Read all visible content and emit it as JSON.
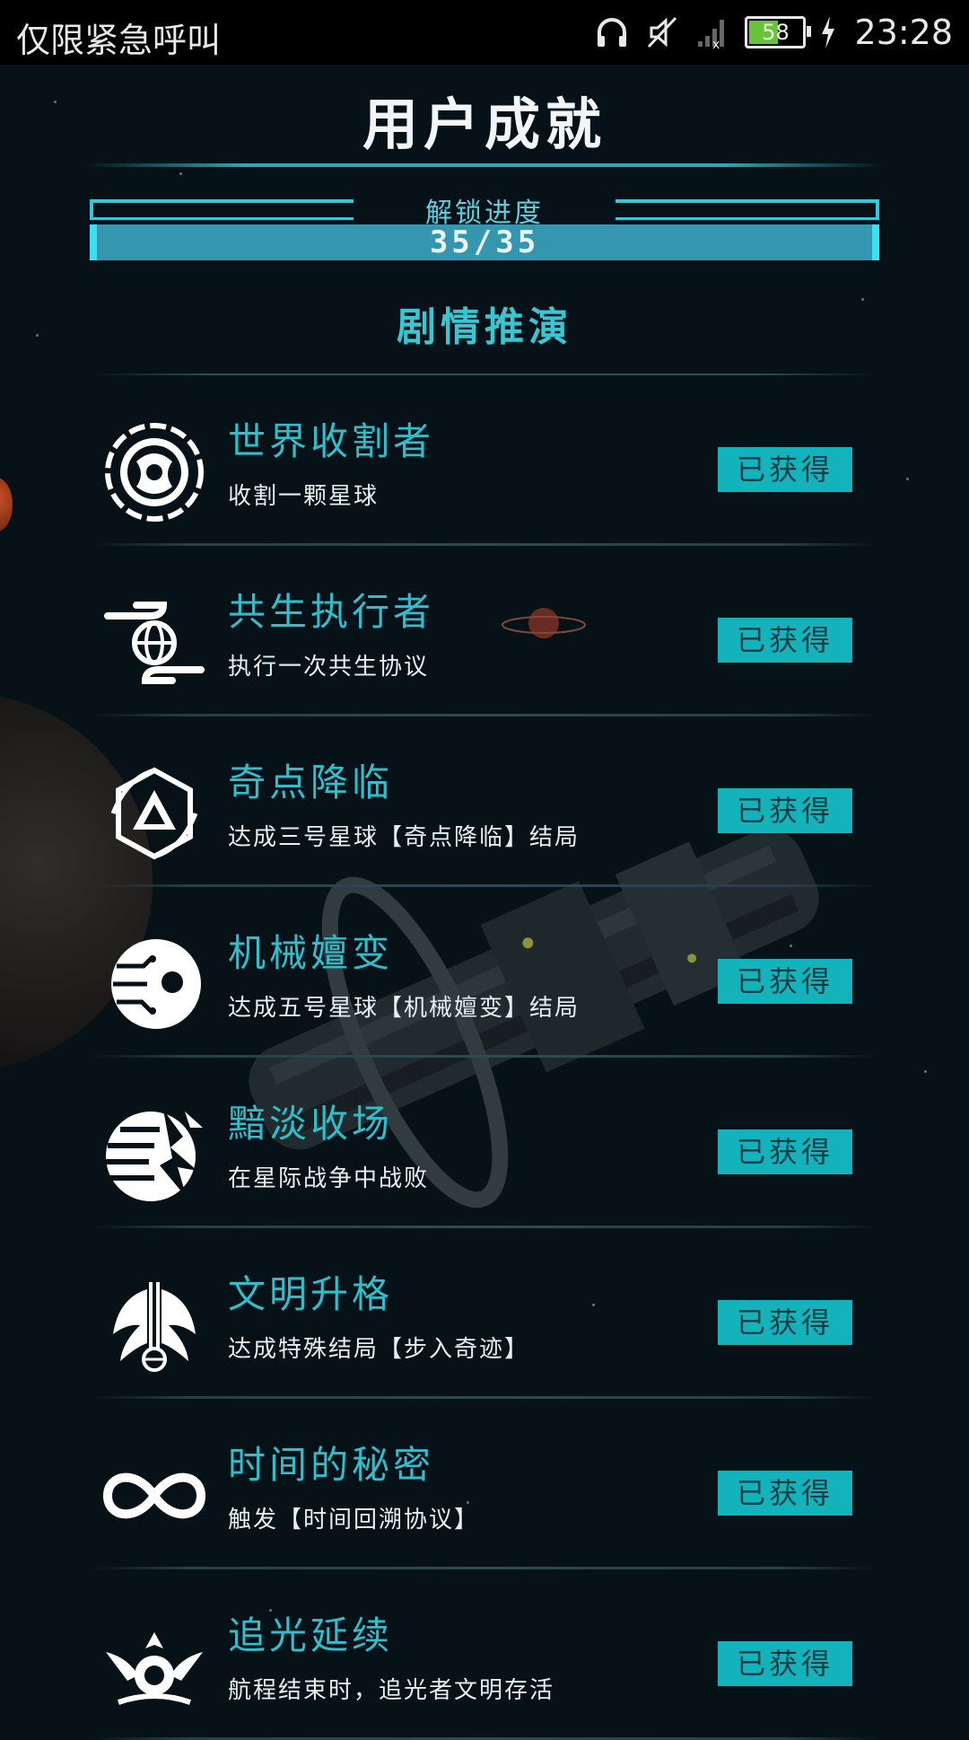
{
  "status_bar": {
    "carrier": "仅限紧急呼叫",
    "battery_level": "58",
    "battery_fraction": 0.58,
    "time": "23:28",
    "icons": [
      "headphones-icon",
      "mute-icon",
      "signal-icon",
      "battery-icon",
      "charging-icon"
    ]
  },
  "header": {
    "title": "用户成就"
  },
  "progress": {
    "label": "解锁进度",
    "text": "35/35",
    "fraction": 1.0
  },
  "section": {
    "title": "剧情推演"
  },
  "achievements": [
    {
      "title": "世界收割者",
      "desc": "收割一颗星球",
      "status": "已获得",
      "icon": "world-harvester-icon"
    },
    {
      "title": "共生执行者",
      "desc": "执行一次共生协议",
      "status": "已获得",
      "icon": "symbiosis-icon"
    },
    {
      "title": "奇点降临",
      "desc": "达成三号星球【奇点降临】结局",
      "status": "已获得",
      "icon": "singularity-icon"
    },
    {
      "title": "机械嬗变",
      "desc": "达成五号星球【机械嬗变】结局",
      "status": "已获得",
      "icon": "mechanical-eye-icon"
    },
    {
      "title": "黯淡收场",
      "desc": "在星际战争中战败",
      "status": "已获得",
      "icon": "shattered-planet-icon"
    },
    {
      "title": "文明升格",
      "desc": "达成特殊结局【步入奇迹】",
      "status": "已获得",
      "icon": "winged-emblem-icon"
    },
    {
      "title": "时间的秘密",
      "desc": "触发【时间回溯协议】",
      "status": "已获得",
      "icon": "infinity-icon"
    },
    {
      "title": "追光延续",
      "desc": "航程结束时，追光者文明存活",
      "status": "已获得",
      "icon": "light-chaser-icon"
    }
  ]
}
